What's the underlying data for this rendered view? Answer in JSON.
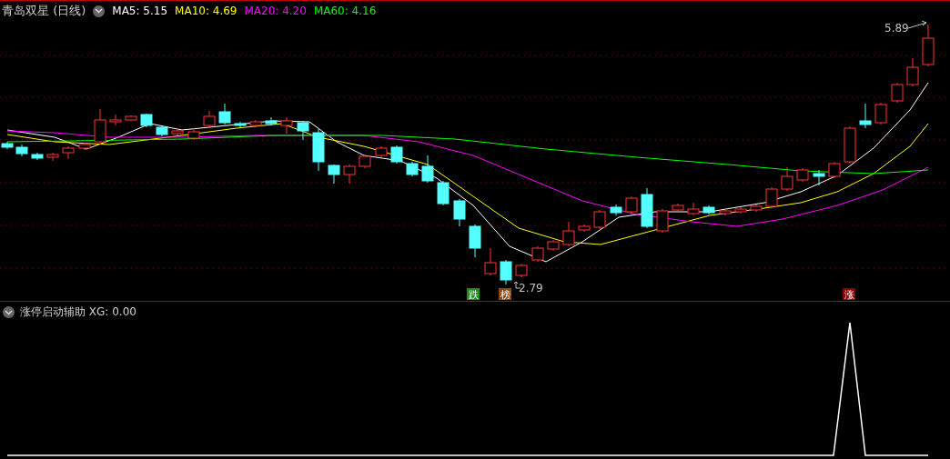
{
  "header": {
    "title": "青岛双星 (日线)",
    "indicators": [
      {
        "label": "MA5: 5.15",
        "color": "#ffffff"
      },
      {
        "label": "MA10: 4.69",
        "color": "#ffff00"
      },
      {
        "label": "MA20: 4.20",
        "color": "#ff00ff"
      },
      {
        "label": "MA60: 4.16",
        "color": "#00ff00"
      }
    ]
  },
  "price_chart": {
    "high_label": "5.89",
    "low_label": "2.79",
    "markers": [
      {
        "text": "跌",
        "color": "#1f8a1f"
      },
      {
        "text": "榜",
        "color": "#8a4a10"
      },
      {
        "text": "涨",
        "color": "#8b0000"
      }
    ]
  },
  "indicator_panel": {
    "title": "涨停启动辅助 XG: 0.00"
  }
}
